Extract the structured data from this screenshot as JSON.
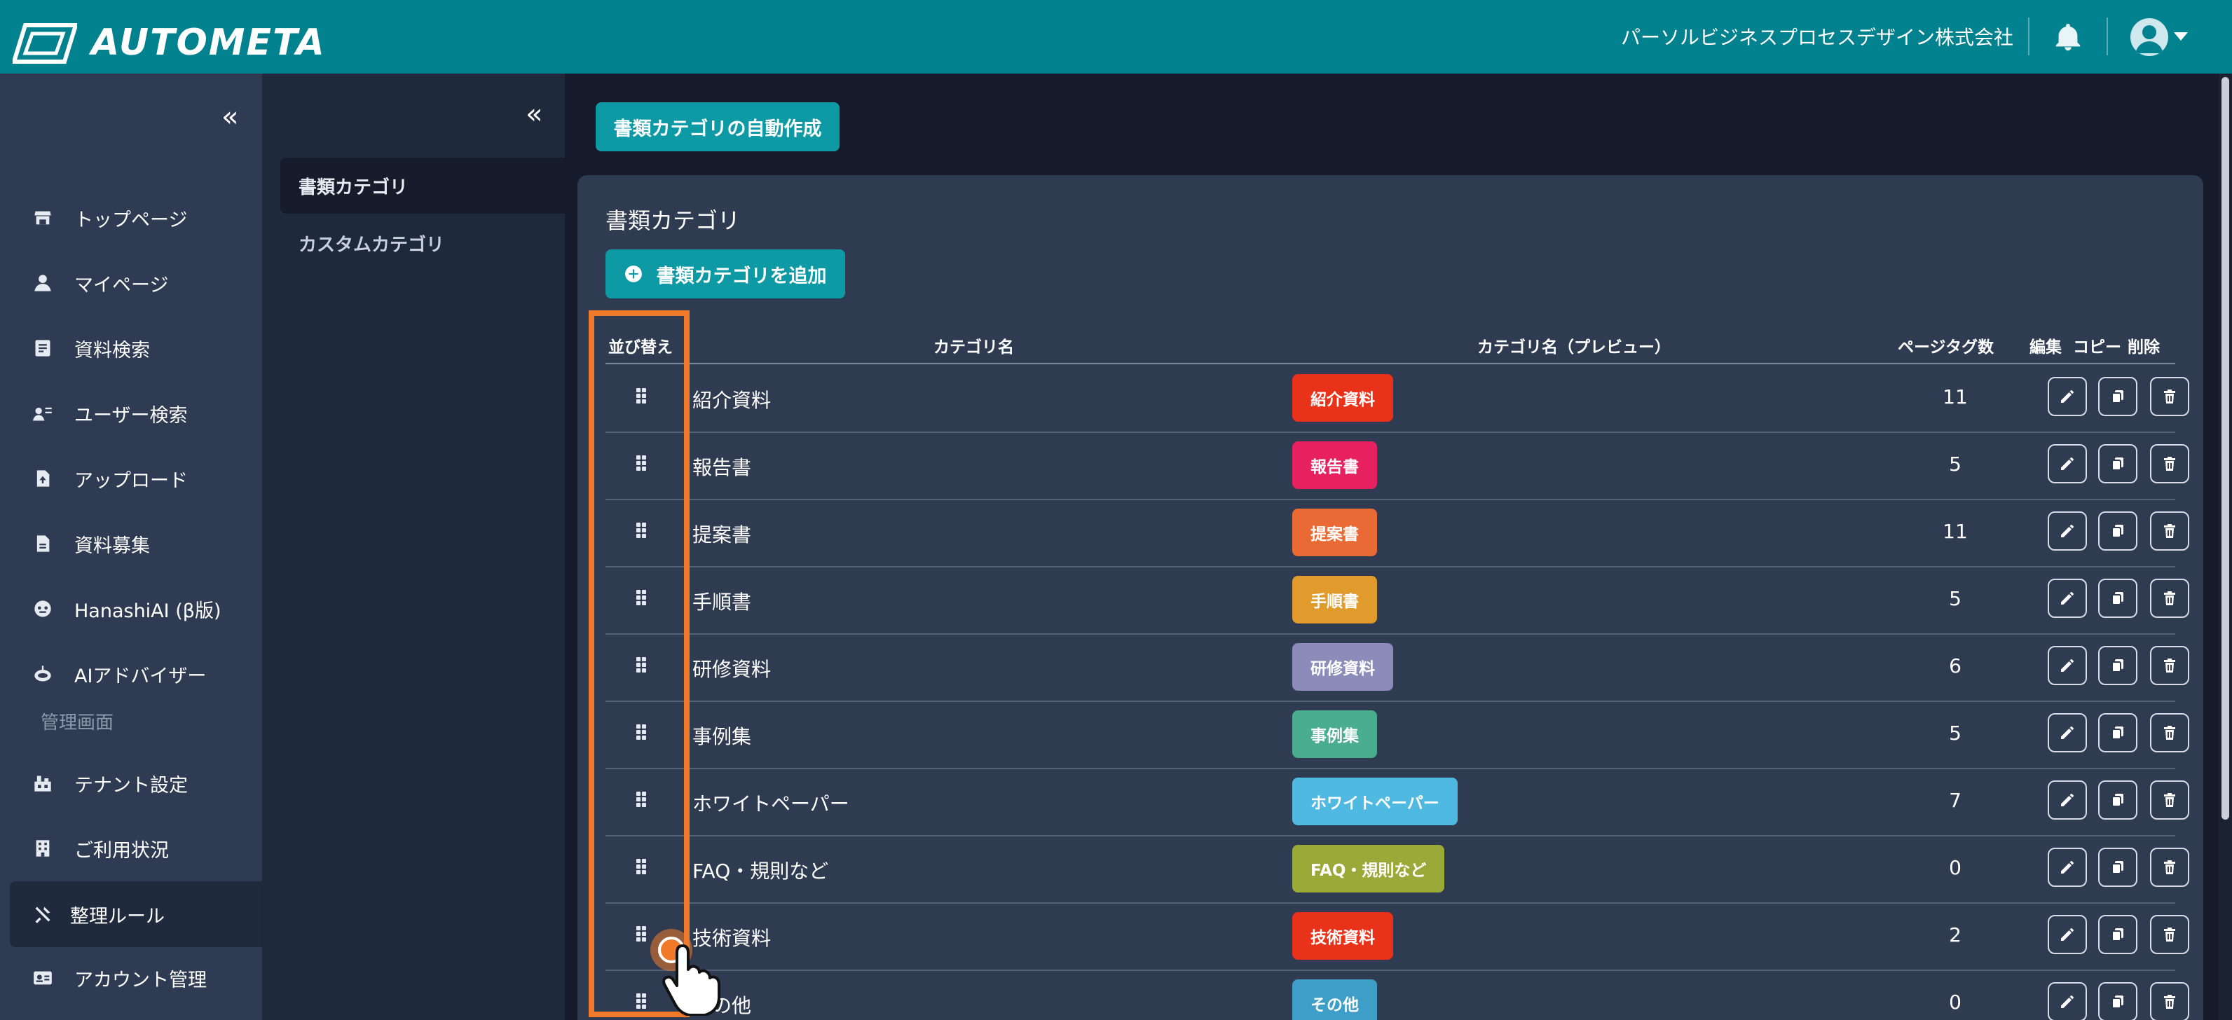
{
  "header": {
    "logo_text": "AUTOMETA",
    "company": "パーソルビジネスプロセスデザイン株式会社"
  },
  "sidebar": {
    "items": [
      {
        "label": "トップページ",
        "icon": "store-icon"
      },
      {
        "label": "マイページ",
        "icon": "person-icon"
      },
      {
        "label": "資料検索",
        "icon": "document-search-icon"
      },
      {
        "label": "ユーザー検索",
        "icon": "user-search-icon"
      },
      {
        "label": "アップロード",
        "icon": "file-upload-icon"
      },
      {
        "label": "資料募集",
        "icon": "file-icon"
      },
      {
        "label": "HanashiAI (β版)",
        "icon": "chat-bot-icon"
      },
      {
        "label": "AIアドバイザー",
        "icon": "robot-icon"
      }
    ],
    "section_label": "管理画面",
    "admin_items": [
      {
        "label": "テナント設定",
        "icon": "tenant-icon"
      },
      {
        "label": "ご利用状況",
        "icon": "building-icon"
      },
      {
        "label": "整理ルール",
        "icon": "tools-icon",
        "active": true
      },
      {
        "label": "アカウント管理",
        "icon": "id-card-icon"
      }
    ]
  },
  "subnav": {
    "items": [
      {
        "label": "書類カテゴリ",
        "active": true
      },
      {
        "label": "カスタムカテゴリ",
        "active": false
      }
    ]
  },
  "main": {
    "auto_create_label": "書類カテゴリの自動作成",
    "card_title": "書類カテゴリ",
    "add_label": "書類カテゴリを追加",
    "columns": {
      "sort": "並び替え",
      "name": "カテゴリ名",
      "preview": "カテゴリ名（プレビュー）",
      "page_tags": "ページタグ数",
      "edit": "編集",
      "copy": "コピー",
      "delete": "削除"
    },
    "rows": [
      {
        "name": "紹介資料",
        "badge": "紹介資料",
        "color": "#e8321a",
        "count": "11"
      },
      {
        "name": "報告書",
        "badge": "報告書",
        "color": "#e72160",
        "count": "5"
      },
      {
        "name": "提案書",
        "badge": "提案書",
        "color": "#ea6a35",
        "count": "11"
      },
      {
        "name": "手順書",
        "badge": "手順書",
        "color": "#e09b2c",
        "count": "5"
      },
      {
        "name": "研修資料",
        "badge": "研修資料",
        "color": "#8c8cba",
        "count": "6"
      },
      {
        "name": "事例集",
        "badge": "事例集",
        "color": "#4aad90",
        "count": "5"
      },
      {
        "name": "ホワイトペーパー",
        "badge": "ホワイトペーパー",
        "color": "#4fb9e2",
        "count": "7"
      },
      {
        "name": "FAQ・規則など",
        "badge": "FAQ・規則など",
        "color": "#9aaa38",
        "count": "0"
      },
      {
        "name": "技術資料",
        "badge": "技術資料",
        "color": "#e8321a",
        "count": "2"
      },
      {
        "name": "その他",
        "badge": "その他",
        "color": "#3f9ec7",
        "count": "0"
      }
    ]
  },
  "colors": {
    "header": "#02828f",
    "accent_button": "#0d9aa5",
    "highlight": "#f07a2a"
  }
}
